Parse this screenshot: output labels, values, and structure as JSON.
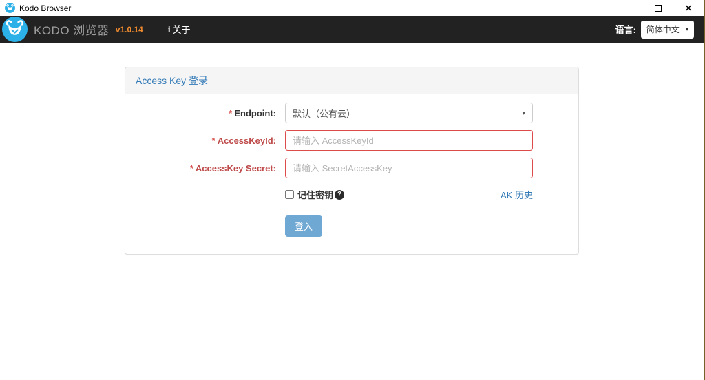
{
  "window": {
    "title": "Kodo Browser",
    "minimize_glyph": "–",
    "close_glyph": "✕"
  },
  "navbar": {
    "brand": "KODO 浏览器",
    "version": "v1.0.14",
    "info_glyph": "i",
    "about": "关于",
    "language_label": "语言:",
    "language_selected": "简体中文",
    "caret_glyph": "▾"
  },
  "colors": {
    "navbar_bg": "#222222",
    "brand_gray": "#9d9d9d",
    "version_orange": "#f08a2e",
    "accent_blue": "#337ab7",
    "error_red": "#dd4b4b",
    "logo_blue": "#2bb0e8",
    "login_button_blue": "#6fa8d3",
    "right_edge_border": "#75622a"
  },
  "login_panel": {
    "title": "Access Key 登录",
    "endpoint": {
      "required": "*",
      "label": "Endpoint:",
      "value": "默认（公有云）",
      "caret": "▾"
    },
    "access_key_id": {
      "required": "*",
      "label": "AccessKeyId:",
      "placeholder": "请输入 AccessKeyId"
    },
    "access_key_secret": {
      "required": "*",
      "label": "AccessKey Secret:",
      "placeholder": "请输入 SecretAccessKey"
    },
    "remember": {
      "label": "记住密钥",
      "help_glyph": "?"
    },
    "ak_history": "AK 历史",
    "login_button": "登入"
  }
}
